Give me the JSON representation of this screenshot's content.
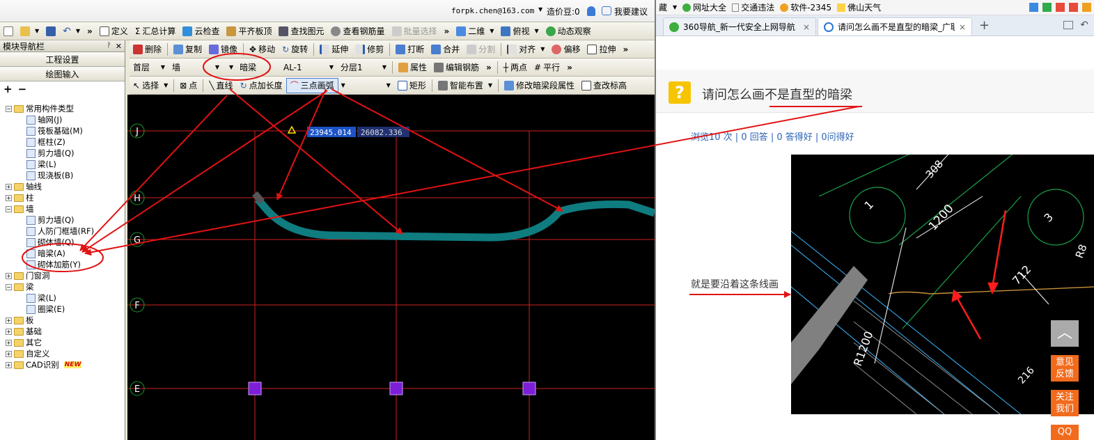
{
  "app": {
    "account": "forpk.chen@163.com",
    "cost_beans": "造价豆:0",
    "suggest": "我要建议",
    "menu1": [
      "定义",
      "汇总计算",
      "云检查",
      "平齐板顶",
      "查找图元",
      "查看钢筋量",
      "批量选择"
    ],
    "menu1_right": [
      "二维",
      "俯视",
      "动态观察"
    ],
    "menu2": [
      "删除",
      "复制",
      "镜像",
      "移动",
      "旋转",
      "延伸",
      "修剪",
      "打断",
      "合并",
      "分割",
      "对齐",
      "偏移",
      "拉伸"
    ],
    "selectors": {
      "floor": "首层",
      "type": "墙",
      "component": "暗梁",
      "name": "AL-1",
      "layer": "分层1"
    },
    "menu3": [
      "属性",
      "编辑钢筋"
    ],
    "menu3_right": [
      "两点",
      "平行"
    ],
    "menu4": {
      "select": "选择",
      "point": "点",
      "line": "直线",
      "point_len": "点加长度",
      "arc3": "三点画弧",
      "rect": "矩形",
      "smart": "智能布置",
      "modify": "修改暗梁段属性",
      "height": "查改标高"
    },
    "chevron": "»",
    "nav": {
      "title": "模块导航栏",
      "pin": "📌",
      "close": "✕",
      "btn1": "工程设置",
      "btn2": "绘图输入",
      "expand": "+",
      "collapse": "−",
      "tree": [
        {
          "label": "常用构件类型",
          "level": 0,
          "kind": "folder",
          "pm": "−"
        },
        {
          "label": "轴网(J)",
          "level": 1,
          "kind": "leaf"
        },
        {
          "label": "筏板基础(M)",
          "level": 1,
          "kind": "leaf"
        },
        {
          "label": "框柱(Z)",
          "level": 1,
          "kind": "leaf"
        },
        {
          "label": "剪力墙(Q)",
          "level": 1,
          "kind": "leaf"
        },
        {
          "label": "梁(L)",
          "level": 1,
          "kind": "leaf"
        },
        {
          "label": "现浇板(B)",
          "level": 1,
          "kind": "leaf"
        },
        {
          "label": "轴线",
          "level": 0,
          "kind": "folder",
          "pm": "+"
        },
        {
          "label": "柱",
          "level": 0,
          "kind": "folder",
          "pm": "+"
        },
        {
          "label": "墙",
          "level": 0,
          "kind": "folder",
          "pm": "−"
        },
        {
          "label": "剪力墙(Q)",
          "level": 1,
          "kind": "leaf"
        },
        {
          "label": "人防门框墙(RF)",
          "level": 1,
          "kind": "leaf"
        },
        {
          "label": "砌体墙(Q)",
          "level": 1,
          "kind": "leaf"
        },
        {
          "label": "暗梁(A)",
          "level": 1,
          "kind": "leaf"
        },
        {
          "label": "砌体加筋(Y)",
          "level": 1,
          "kind": "leaf"
        },
        {
          "label": "门窗洞",
          "level": 0,
          "kind": "folder",
          "pm": "+"
        },
        {
          "label": "梁",
          "level": 0,
          "kind": "folder",
          "pm": "−"
        },
        {
          "label": "梁(L)",
          "level": 1,
          "kind": "leaf"
        },
        {
          "label": "圈梁(E)",
          "level": 1,
          "kind": "leaf"
        },
        {
          "label": "板",
          "level": 0,
          "kind": "folder",
          "pm": "+"
        },
        {
          "label": "基础",
          "level": 0,
          "kind": "folder",
          "pm": "+"
        },
        {
          "label": "其它",
          "level": 0,
          "kind": "folder",
          "pm": "+"
        },
        {
          "label": "自定义",
          "level": 0,
          "kind": "folder",
          "pm": "+"
        },
        {
          "label": "CAD识别",
          "level": 0,
          "kind": "folder",
          "pm": "+"
        }
      ],
      "new_badge": "NEW"
    },
    "canvas": {
      "axis_labels": [
        "J",
        "H",
        "G",
        "F",
        "E"
      ],
      "coord_x": "23945.014",
      "coord_y": "26082.336",
      "grid_color": "#d11f1f",
      "beam_color": "#0f7c80",
      "column_color": "#7d1fd6",
      "annotation_color": "#e21212"
    }
  },
  "browser": {
    "fav": [
      "藏",
      "网址大全",
      "交通违法",
      "软件-2345",
      "佛山天气"
    ],
    "tabs": [
      {
        "label": "360导航_新一代安全上网导航",
        "close": "×"
      },
      {
        "label": "请问怎么画不是直型的暗梁_广联",
        "close": "×"
      }
    ],
    "new_tab": "+",
    "question_mark": "?",
    "question_title": "请问怎么画不是直型的暗梁",
    "stats": "浏览10 次 | 0 回答 | 0 答得好 | 0问得好",
    "pic_caption": "就是要沿着这条线画",
    "pic_labels": {
      "l1": "1",
      "l3": "3",
      "d308": "308",
      "d1200": "1200",
      "d712": "712",
      "r1200": "R1200",
      "d216": "216",
      "r8": "R8"
    },
    "side_buttons": {
      "top": "︿",
      "feedback": "意见\n反馈",
      "follow": "关注\n我们",
      "qq": "QQ"
    }
  }
}
